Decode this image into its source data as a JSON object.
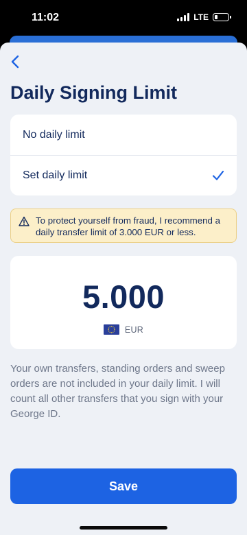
{
  "status_bar": {
    "time": "11:02",
    "network": "LTE"
  },
  "header": {
    "title": "Daily Signing Limit"
  },
  "options": [
    {
      "label": "No daily limit",
      "selected": false
    },
    {
      "label": "Set daily limit",
      "selected": true
    }
  ],
  "warning": {
    "text": "To protect yourself from fraud, I recommend a daily transfer limit of 3.000 EUR or less."
  },
  "amount": {
    "value": "5.000",
    "currency": "EUR"
  },
  "info": {
    "text": "Your own transfers, standing orders and sweep orders are not included in your daily limit. I will count all other transfers that you sign with your George ID."
  },
  "footer": {
    "save_label": "Save"
  },
  "colors": {
    "primary": "#1d63e3",
    "title": "#12295c",
    "background": "#eef1f6",
    "warning_bg": "#fcefc9"
  }
}
